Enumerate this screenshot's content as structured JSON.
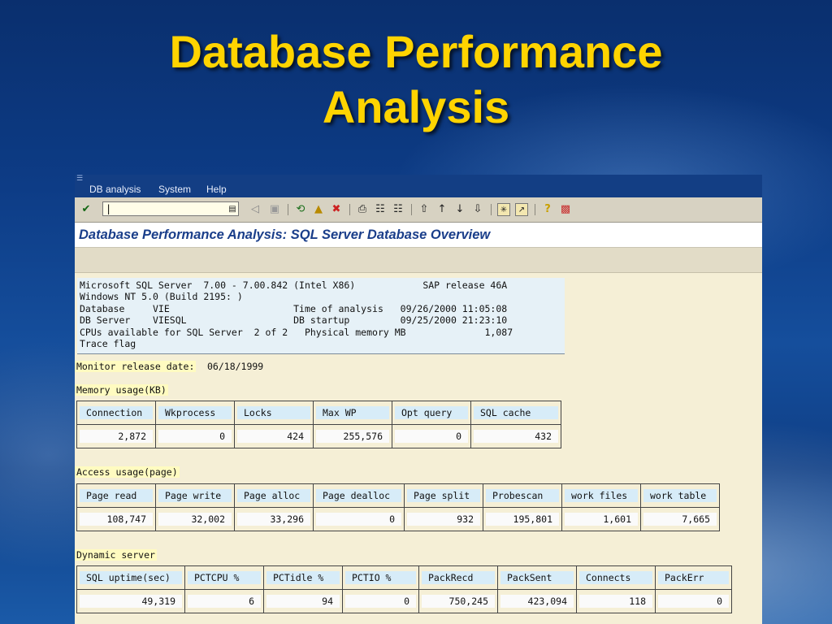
{
  "slide": {
    "title_line1": "Database Performance",
    "title_line2": "Analysis"
  },
  "menu": {
    "items": [
      "DB analysis",
      "System",
      "Help"
    ]
  },
  "toolbar": {
    "command_value": "|"
  },
  "window_title": "Database Performance Analysis: SQL Server Database Overview",
  "info": {
    "lines": [
      "Microsoft SQL Server  7.00 - 7.00.842 (Intel X86)            SAP release 46A",
      "Windows NT 5.0 (Build 2195: )",
      "Database     VIE                      Time of analysis   09/26/2000 11:05:08",
      "DB Server    VIESQL                   DB startup         09/25/2000 21:23:10",
      "CPUs available for SQL Server  2 of 2   Physical memory MB              1,087",
      "Trace flag"
    ]
  },
  "monitor": {
    "label": "Monitor release date:",
    "value": "06/18/1999"
  },
  "memory": {
    "label": "Memory usage(KB)",
    "headers": [
      "Connection",
      "Wkprocess",
      "Locks",
      "Max WP",
      "Opt query",
      "SQL cache"
    ],
    "values": [
      "2,872",
      "0",
      "424",
      "255,576",
      "0",
      "432"
    ]
  },
  "access": {
    "label": "Access usage(page)",
    "headers": [
      "Page read",
      "Page write",
      "Page alloc",
      "Page dealloc",
      "Page split",
      "Probescan",
      "work files",
      "work table"
    ],
    "values": [
      "108,747",
      "32,002",
      "33,296",
      "0",
      "932",
      "195,801",
      "1,601",
      "7,665"
    ]
  },
  "dynamic": {
    "label": "Dynamic server",
    "headers": [
      "SQL uptime(sec)",
      "PCTCPU %",
      "PCTidle %",
      "PCTIO %",
      "PackRecd",
      "PackSent",
      "Connects",
      "PackErr"
    ],
    "values": [
      "49,319",
      "6",
      "94",
      "0",
      "750,245",
      "423,094",
      "118",
      "0"
    ]
  }
}
